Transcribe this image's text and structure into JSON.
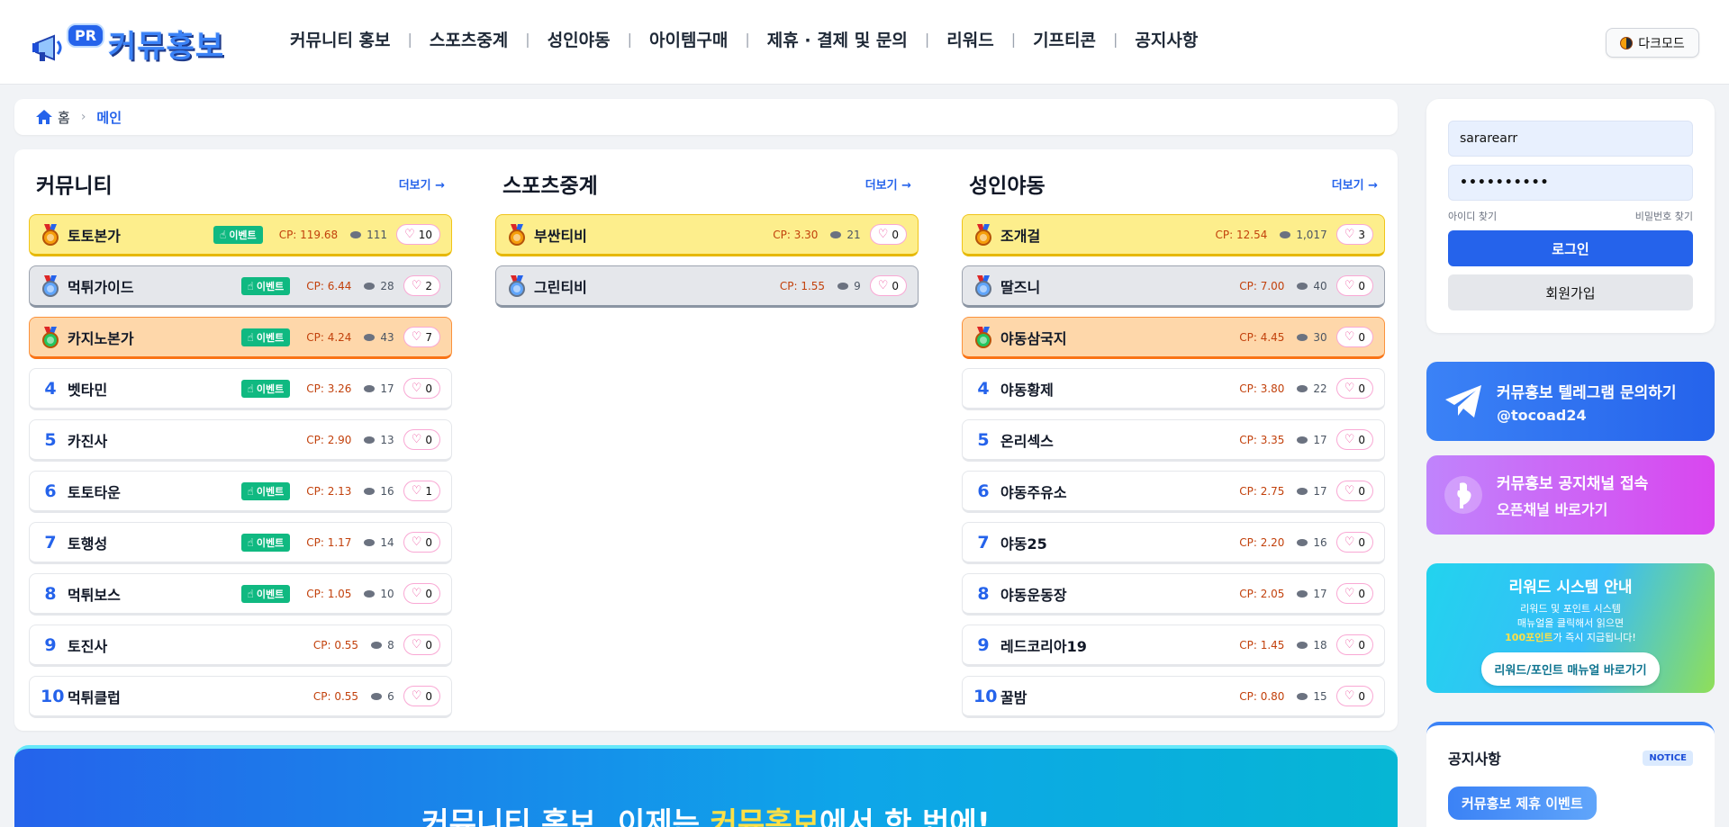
{
  "header": {
    "logo_badge": "PR",
    "logo_text": "커뮤홍보",
    "nav": [
      "커뮤니티 홍보",
      "스포츠중계",
      "성인야동",
      "아이템구매",
      "제휴 · 결제 및 문의",
      "리워드",
      "기프티콘",
      "공지사항"
    ],
    "dark_mode_label": "다크모드"
  },
  "breadcrumb": {
    "home": "홈",
    "current": "메인"
  },
  "columns": [
    {
      "title": "커뮤니티",
      "more": "더보기 →",
      "rows": [
        {
          "rank": "1",
          "tier": "gold",
          "name": "토토본가",
          "event": "이벤트",
          "cp": "CP: 119.68",
          "views": "111",
          "likes": "10"
        },
        {
          "rank": "2",
          "tier": "silver",
          "name": "먹튀가이드",
          "event": "이벤트",
          "cp": "CP: 6.44",
          "views": "28",
          "likes": "2"
        },
        {
          "rank": "3",
          "tier": "bronze",
          "name": "카지노본가",
          "event": "이벤트",
          "cp": "CP: 4.24",
          "views": "43",
          "likes": "7"
        },
        {
          "rank": "4",
          "tier": "",
          "name": "벳타민",
          "event": "이벤트",
          "cp": "CP: 3.26",
          "views": "17",
          "likes": "0"
        },
        {
          "rank": "5",
          "tier": "",
          "name": "카진사",
          "event": "",
          "cp": "CP: 2.90",
          "views": "13",
          "likes": "0"
        },
        {
          "rank": "6",
          "tier": "",
          "name": "토토타운",
          "event": "이벤트",
          "cp": "CP: 2.13",
          "views": "16",
          "likes": "1"
        },
        {
          "rank": "7",
          "tier": "",
          "name": "토행성",
          "event": "이벤트",
          "cp": "CP: 1.17",
          "views": "14",
          "likes": "0"
        },
        {
          "rank": "8",
          "tier": "",
          "name": "먹튀보스",
          "event": "이벤트",
          "cp": "CP: 1.05",
          "views": "10",
          "likes": "0"
        },
        {
          "rank": "9",
          "tier": "",
          "name": "토진사",
          "event": "",
          "cp": "CP: 0.55",
          "views": "8",
          "likes": "0"
        },
        {
          "rank": "10",
          "tier": "",
          "name": "먹튀클럽",
          "event": "",
          "cp": "CP: 0.55",
          "views": "6",
          "likes": "0"
        }
      ]
    },
    {
      "title": "스포츠중계",
      "more": "더보기 →",
      "rows": [
        {
          "rank": "1",
          "tier": "gold",
          "name": "부싼티비",
          "event": "",
          "cp": "CP: 3.30",
          "views": "21",
          "likes": "0"
        },
        {
          "rank": "2",
          "tier": "silver",
          "name": "그린티비",
          "event": "",
          "cp": "CP: 1.55",
          "views": "9",
          "likes": "0"
        }
      ]
    },
    {
      "title": "성인야동",
      "more": "더보기 →",
      "rows": [
        {
          "rank": "1",
          "tier": "gold",
          "name": "조개걸",
          "event": "",
          "cp": "CP: 12.54",
          "views": "1,017",
          "likes": "3"
        },
        {
          "rank": "2",
          "tier": "silver",
          "name": "딸즈니",
          "event": "",
          "cp": "CP: 7.00",
          "views": "40",
          "likes": "0"
        },
        {
          "rank": "3",
          "tier": "bronze",
          "name": "야동삼국지",
          "event": "",
          "cp": "CP: 4.45",
          "views": "30",
          "likes": "0"
        },
        {
          "rank": "4",
          "tier": "",
          "name": "야동황제",
          "event": "",
          "cp": "CP: 3.80",
          "views": "22",
          "likes": "0"
        },
        {
          "rank": "5",
          "tier": "",
          "name": "온리섹스",
          "event": "",
          "cp": "CP: 3.35",
          "views": "17",
          "likes": "0"
        },
        {
          "rank": "6",
          "tier": "",
          "name": "야동주유소",
          "event": "",
          "cp": "CP: 2.75",
          "views": "17",
          "likes": "0"
        },
        {
          "rank": "7",
          "tier": "",
          "name": "야동25",
          "event": "",
          "cp": "CP: 2.20",
          "views": "16",
          "likes": "0"
        },
        {
          "rank": "8",
          "tier": "",
          "name": "야동운동장",
          "event": "",
          "cp": "CP: 2.05",
          "views": "17",
          "likes": "0"
        },
        {
          "rank": "9",
          "tier": "",
          "name": "레드코리아19",
          "event": "",
          "cp": "CP: 1.45",
          "views": "18",
          "likes": "0"
        },
        {
          "rank": "10",
          "tier": "",
          "name": "꿀밤",
          "event": "",
          "cp": "CP: 0.80",
          "views": "15",
          "likes": "0"
        }
      ]
    }
  ],
  "banner": {
    "text_prefix": "커뮤니티 홍보, 이제는 ",
    "highlight": "커뮤홍보",
    "text_suffix": "에서 한 번에!"
  },
  "login": {
    "username_value": "sararearr",
    "password_value": "••••••••••",
    "find_id": "아이디 찾기",
    "find_pw": "비밀번호 찾기",
    "login_button": "로그인",
    "join_button": "회원가입"
  },
  "telegram_card": {
    "line1": "커뮤홍보 텔레그램 문의하기",
    "line2": "@tocoad24"
  },
  "kakao_card": {
    "line1": "커뮤홍보 공지채널 접속",
    "line2": "오픈채널 바로가기"
  },
  "reward_card": {
    "title": "리워드 시스템 안내",
    "desc1": "리워드 및 포인트 시스템",
    "desc2": "매뉴얼을 클릭해서 읽으면",
    "desc3_hl": "100포인트",
    "desc3_rest": "가 즉시 지급됩니다!",
    "button": "리워드/포인트 매뉴얼 바로가기"
  },
  "notice": {
    "title": "공지사항",
    "badge": "NOTICE",
    "first_item": "커뮤홍보 제휴 이벤트"
  },
  "colors": {
    "accent": "#2563eb",
    "gold": "#fdee8c",
    "silver": "#e5e7eb",
    "bronze": "#fed7aa",
    "event": "#10b981"
  }
}
